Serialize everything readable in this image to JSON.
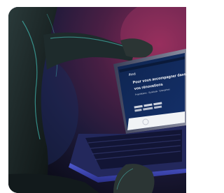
{
  "image": {
    "alt": "",
    "screen": {
      "logo": "Ifred",
      "headline_line1": "Pour vous accompagner dans",
      "headline_line2": "vos rénovations",
      "subline": "Propriétaires · Syndicats · Entreprises"
    }
  }
}
